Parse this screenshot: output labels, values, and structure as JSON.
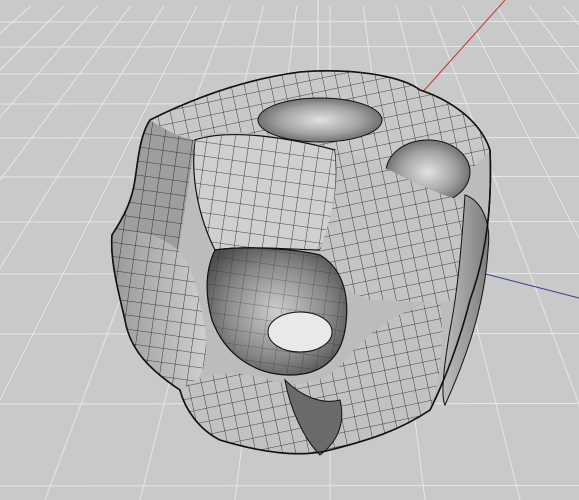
{
  "viewport": {
    "background_color": "#c9c9c9",
    "grid_color": "#e6e6e6",
    "axis_x_color": "#c0392b",
    "axis_y_color": "#2c3e99",
    "axis_z_color": "#eeeeee",
    "mesh_light_color": "#d6d6d6",
    "mesh_mid_color": "#a8a8a8",
    "mesh_dark_color": "#5a5a5a",
    "wire_color": "#111111",
    "show_grid": true,
    "object_type": "subdivided-polygon-mesh",
    "view": "perspective"
  }
}
